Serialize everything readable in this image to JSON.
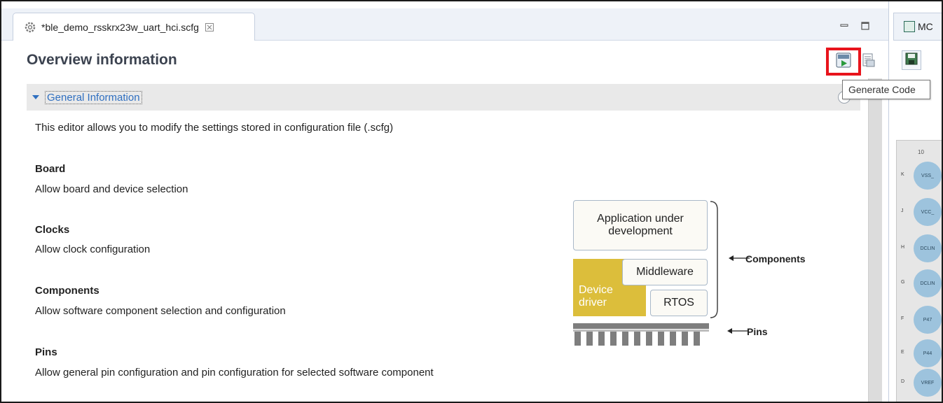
{
  "editor": {
    "tab_title": "*ble_demo_rsskrx23w_uart_hci.scfg",
    "close_glyph": "☒",
    "title": "Overview information",
    "section_title": "General Information",
    "intro": "This editor allows you to modify the settings stored in configuration file (.scfg)",
    "items": [
      {
        "heading": "Board",
        "desc": "Allow board and device selection"
      },
      {
        "heading": "Clocks",
        "desc": "Allow clock configuration"
      },
      {
        "heading": "Components",
        "desc": "Allow software component selection and configuration"
      },
      {
        "heading": "Pins",
        "desc": "Allow general pin configuration and pin configuration for selected software component"
      }
    ],
    "tooltip": "Generate Code"
  },
  "diagram": {
    "app": "Application under development",
    "middleware": "Middleware",
    "device_driver": "Device driver",
    "rtos": "RTOS",
    "components_label": "Components",
    "pins_label": "Pins"
  },
  "right_pane": {
    "tab_label": "MC",
    "col_header": "10",
    "rows": [
      {
        "row": "K",
        "pin": "VSS_"
      },
      {
        "row": "J",
        "pin": "VCC_"
      },
      {
        "row": "H",
        "pin": "DCLIN"
      },
      {
        "row": "G",
        "pin": "DCLIN"
      },
      {
        "row": "F",
        "pin": "P47"
      },
      {
        "row": "E",
        "pin": "P44"
      },
      {
        "row": "D",
        "pin": "VREF"
      }
    ]
  },
  "colors": {
    "highlight": "#e8141c",
    "link": "#2f6fc0",
    "device_driver": "#dcbe3b",
    "pin": "#9dc3dd"
  },
  "icons": [
    "gear-icon",
    "close-icon",
    "minimize-icon",
    "maximize-icon",
    "generate-code-icon",
    "generate-report-icon",
    "expand-arrow-icon",
    "help-icon",
    "chip-icon",
    "save-icon"
  ]
}
